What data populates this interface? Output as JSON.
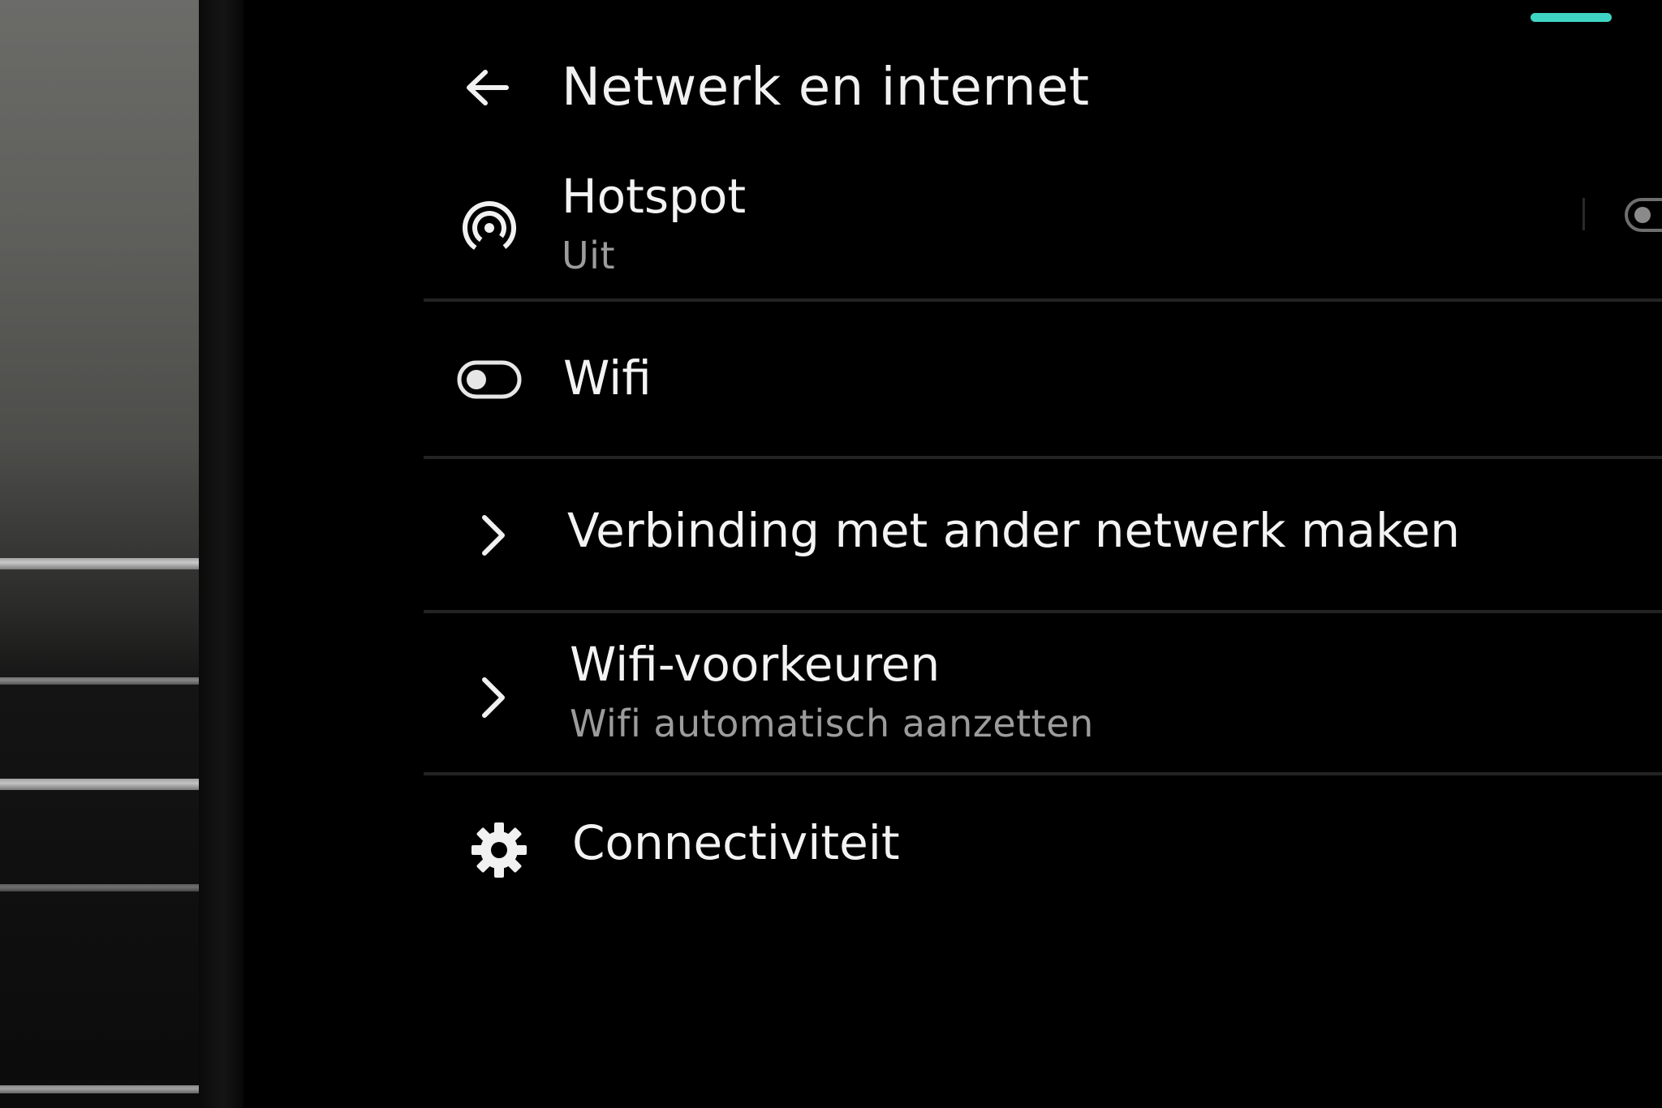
{
  "header": {
    "back_icon": "arrow-left-icon",
    "title": "Netwerk en internet"
  },
  "status_bar": {
    "indicator_color": "#3ed6c2"
  },
  "items": [
    {
      "id": "hotspot",
      "icon": "hotspot-icon",
      "label": "Hotspot",
      "sublabel": "Uit",
      "trailing": "toggle-off"
    },
    {
      "id": "wifi",
      "icon": "toggle-off-icon",
      "label": "Wifi"
    },
    {
      "id": "other-network",
      "icon": "chevron-right-icon",
      "label": "Verbinding met ander netwerk maken"
    },
    {
      "id": "wifi-prefs",
      "icon": "chevron-right-icon",
      "label": "Wifi-voorkeuren",
      "sublabel": "Wifi automatisch aanzetten"
    },
    {
      "id": "connectivity",
      "icon": "gear-icon",
      "label": "Connectiviteit"
    }
  ]
}
